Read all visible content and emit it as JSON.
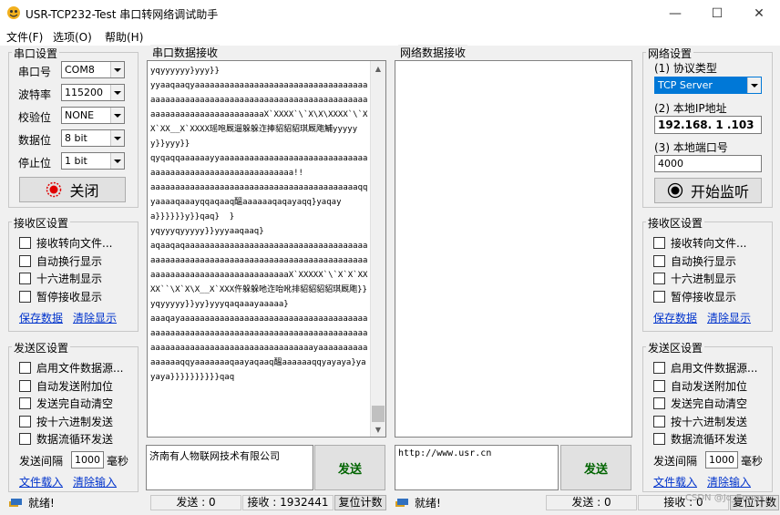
{
  "window": {
    "title": "USR-TCP232-Test 串口转网络调试助手",
    "minimize": "—",
    "maximize": "☐",
    "close": "✕"
  },
  "menu": {
    "file": "文件(F)",
    "options": "选项(O)",
    "help": "帮助(H)"
  },
  "serial_settings": {
    "title": "串口设置",
    "port_label": "串口号",
    "port_value": "COM8",
    "baud_label": "波特率",
    "baud_value": "115200",
    "parity_label": "校验位",
    "parity_value": "NONE",
    "databits_label": "数据位",
    "databits_value": "8 bit",
    "stopbits_label": "停止位",
    "stopbits_value": "1 bit",
    "close_button": "关闭"
  },
  "left_recv_settings": {
    "title": "接收区设置",
    "options": [
      "接收转向文件...",
      "自动换行显示",
      "十六进制显示",
      "暂停接收显示"
    ],
    "save_data": "保存数据",
    "clear_display": "清除显示"
  },
  "left_send_settings": {
    "title": "发送区设置",
    "options": [
      "启用文件数据源...",
      "自动发送附加位",
      "发送完自动清空",
      "按十六进制发送",
      "数据流循环发送"
    ],
    "interval_label": "发送间隔",
    "interval_value": "1000",
    "interval_unit": "毫秒",
    "load_file": "文件载入",
    "clear_input": "清除输入"
  },
  "serial_recv": {
    "title": "串口数据接收",
    "text": "yqyyyyyy}yyy}}\nyyaaqaaqyaaaaaaaaaaaaaaaaaaaaaaaaaaaaaaaaaaaaaaaaaaaaaaaaaaaaaaaaaaaaaaaaaaaaaaaaaaaaaaaaaaaaaaaaaaaaaaaaaaaaaaX`XXXX`\\`X\\X\\XXXX`\\`XX`XX__X`XXXX瑶咆厩遛躲躲迮捧貂貂貂琪厩飑鯆yyyyyy}}yyy}}\nqyqaqqaaaaaayyaaaaaaaaaaaaaaaaaaaaaaaaaaaaaaaaaaaaaaaaaaaaaaaaaaaaaaaaaaa!!\naaaaaaaaaaaaaaaaaaaaaaaaaaaaaaaaaaaaaaaaaaqqyaaaaqaaayqqaqaaq醞aaaaaaqaqayaqq}yaqaya}}}}}}y}}qaq}  }\nyqyyyqyyyyy}}yyyaaqaaq}\naqaaqaqaaaaaaaaaaaaaaaaaaaaaaaaaaaaaaaaaaaaaaaaaaaaaaaaaaaaaaaaaaaaaaaaaaaaaaaaaaaaaaaaaaaaaaaaaaaaaaaaaaaaaaaaaaaaaX`XXXXX`\\`X`X`XXXX``\\X`X\\X__X`XXX仵躲躲吔迮咍吪排貂貂貂貂琪厩飑}}yqyyyyy}}yy}yyyqaqaaayaaaaa}\naaaqayaaaaaaaaaaaaaaaaaaaaaaaaaaaaaaaaaaaaaaaaaaaaaaaaaaaaaaaaaaaaaaaaaaaaaaaaaaaaaaaaaaaaaaaaaaaaaaaaaaaaaaaaaaaaaaaaaaayaaaaaaaaaaaaaaaaqqyaaaaaaaqaayaqaaq醞aaaaaaqqyayaya}yayaya}}}}}}}}}}qaq",
    "send_text": "济南有人物联网技术有限公司",
    "send_button": "发送"
  },
  "net_recv": {
    "title": "网络数据接收",
    "send_text": "http://www.usr.cn",
    "send_button": "发送"
  },
  "net_settings": {
    "title": "网络设置",
    "protocol_label": "(1) 协议类型",
    "protocol_value": "TCP Server",
    "ip_label": "(2) 本地IP地址",
    "ip_value": "192.168. 1 .103",
    "port_label": "(3) 本地端口号",
    "port_value": "4000",
    "start_button": "开始监听"
  },
  "right_recv_settings": {
    "title": "接收区设置",
    "options": [
      "接收转向文件...",
      "自动换行显示",
      "十六进制显示",
      "暂停接收显示"
    ],
    "save_data": "保存数据",
    "clear_display": "清除显示"
  },
  "right_send_settings": {
    "title": "发送区设置",
    "options": [
      "启用文件数据源...",
      "自动发送附加位",
      "发送完自动清空",
      "按十六进制发送",
      "数据流循环发送"
    ],
    "interval_label": "发送间隔",
    "interval_value": "1000",
    "interval_unit": "毫秒",
    "load_file": "文件载入",
    "clear_input": "清除输入"
  },
  "status_left": {
    "ready": "就绪!",
    "send_count": "发送 : 0",
    "recv_count": "接收 : 1932441",
    "reset": "复位计数"
  },
  "status_right": {
    "ready": "就绪!",
    "send_count": "发送 : 0",
    "recv_count": "接收 : 0",
    "reset": "复位计数"
  },
  "watermark": "CSDN @Jo_Emms",
  "colors": {
    "selected_combo": "#0078d7",
    "send_button_text": "#006400",
    "link": "#0033cc",
    "record_icon": "#e00000"
  }
}
